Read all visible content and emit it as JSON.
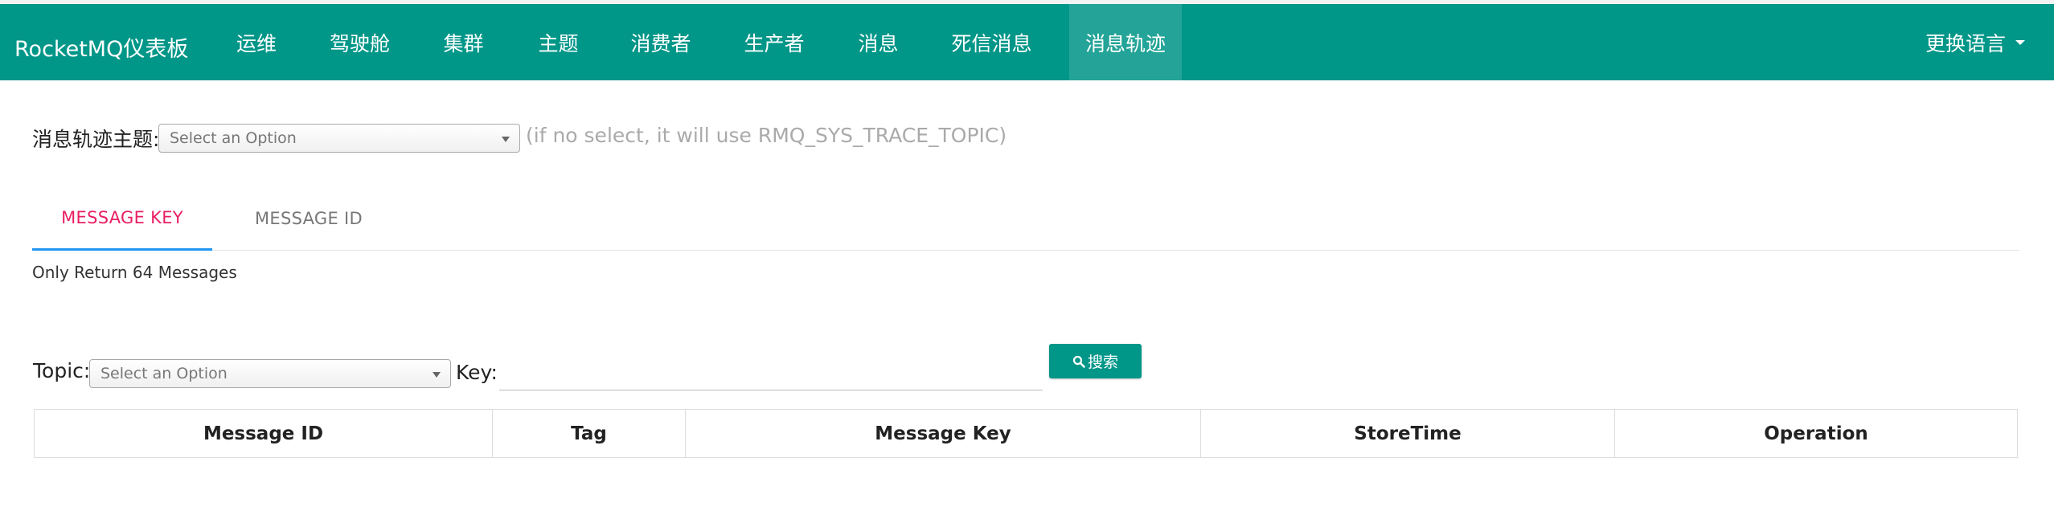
{
  "brand": "RocketMQ仪表板",
  "nav": [
    {
      "label": "运维"
    },
    {
      "label": "驾驶舱"
    },
    {
      "label": "集群"
    },
    {
      "label": "主题"
    },
    {
      "label": "消费者"
    },
    {
      "label": "生产者"
    },
    {
      "label": "消息"
    },
    {
      "label": "死信消息"
    },
    {
      "label": "消息轨迹",
      "active": true
    }
  ],
  "language_label": "更换语言",
  "trace_topic": {
    "label": "消息轨迹主题:",
    "placeholder": "Select an Option",
    "hint": "(if no select, it will use RMQ_SYS_TRACE_TOPIC)"
  },
  "tabs": [
    {
      "label": "MESSAGE KEY",
      "active": true
    },
    {
      "label": "MESSAGE ID",
      "active": false
    }
  ],
  "note": "Only Return 64 Messages",
  "query": {
    "topic_label": "Topic:",
    "topic_placeholder": "Select an Option",
    "key_label": "Key:",
    "key_value": "",
    "search_label": "搜索"
  },
  "table": {
    "columns": [
      "Message ID",
      "Tag",
      "Message Key",
      "StoreTime",
      "Operation"
    ],
    "rows": []
  },
  "colors": {
    "primary": "#009688",
    "active_tab_text": "#e91e63",
    "active_tab_underline": "#2196f3"
  },
  "icons": {
    "search": "search-icon",
    "language_caret": "caret-down-icon",
    "select_caret": "select-arrow-icon"
  }
}
